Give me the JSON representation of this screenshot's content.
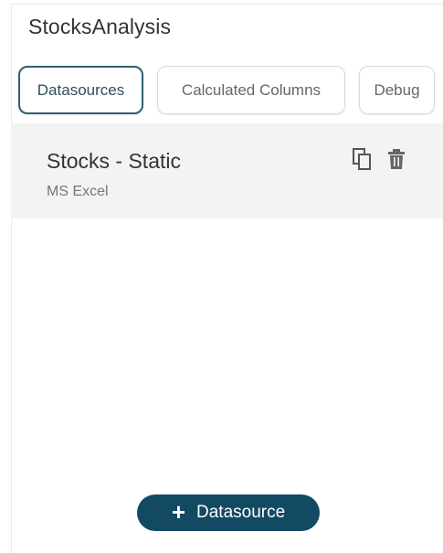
{
  "header": {
    "title": "StocksAnalysis"
  },
  "tabs": [
    {
      "label": "Datasources",
      "active": true
    },
    {
      "label": "Calculated Columns",
      "active": false
    },
    {
      "label": "Debug",
      "active": false
    }
  ],
  "datasources": [
    {
      "name": "Stocks - Static",
      "type": "MS Excel",
      "actions": [
        "copy-icon",
        "trash-icon"
      ]
    }
  ],
  "footer": {
    "add_button_label": "Datasource",
    "add_button_icon": "plus-icon"
  },
  "colors": {
    "accent": "#124a63",
    "active_tab_border": "#2f5f72",
    "selected_row_bg": "#f3f3f3"
  }
}
